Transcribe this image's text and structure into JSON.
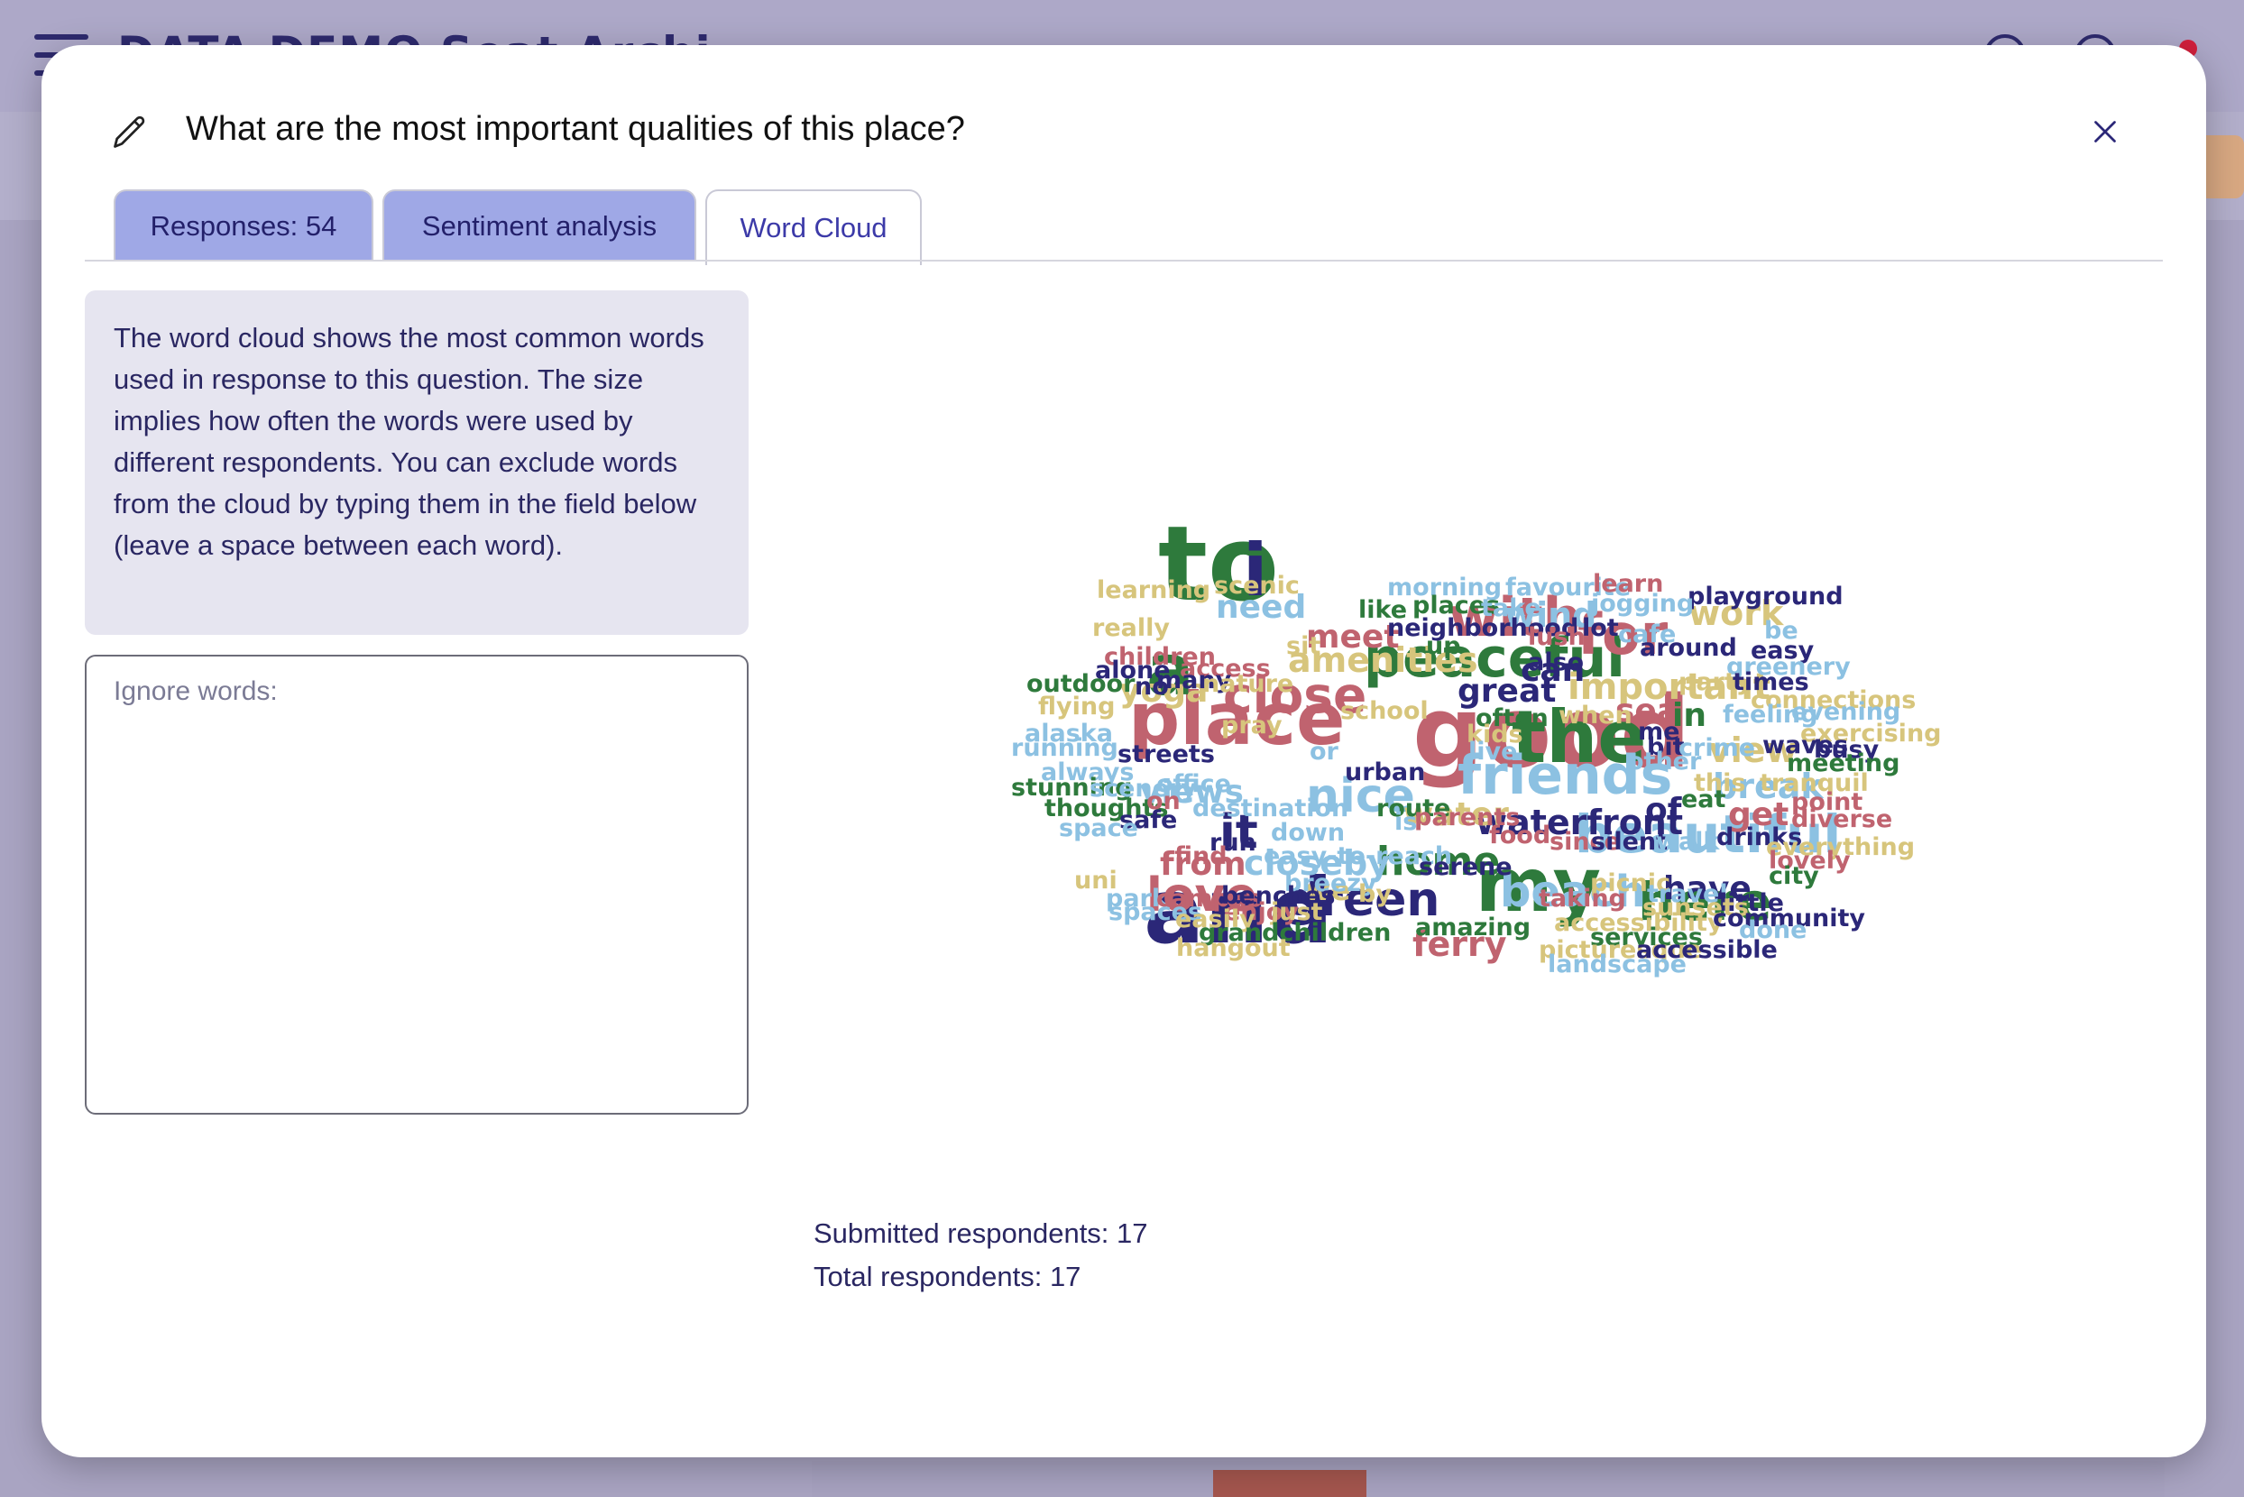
{
  "background": {
    "app_title": "DATA DEMO Seat Archi..."
  },
  "modal": {
    "title": "What are the most important qualities of this place?",
    "tabs": [
      {
        "label": "Responses: 54",
        "active": false
      },
      {
        "label": "Sentiment analysis",
        "active": false
      },
      {
        "label": "Word Cloud",
        "active": true
      }
    ],
    "info_text": "The word cloud shows the most common words used in response to this question. The size implies how often the words were used by different respondents. You can exclude words from the cloud by typing them in the field below (leave a space between each word).",
    "ignore_placeholder": "Ignore words:",
    "ignore_value": "",
    "submitted_label": "Submitted respondents: 17",
    "total_label": "Total respondents: 17"
  },
  "colors": {
    "green": "#2e7a3c",
    "pink": "#c0636f",
    "navy": "#2b2778",
    "lightblue": "#8cc1e2",
    "khaki": "#d7c57c"
  },
  "word_cloud": [
    {
      "text": "good",
      "weight": "xl",
      "color": "pink"
    },
    {
      "text": "to",
      "weight": "xl",
      "color": "green"
    },
    {
      "text": "and",
      "weight": "xl",
      "color": "navy"
    },
    {
      "text": "the",
      "weight": "l",
      "color": "green"
    },
    {
      "text": "place",
      "weight": "l",
      "color": "pink"
    },
    {
      "text": "my",
      "weight": "l",
      "color": "green"
    },
    {
      "text": "a",
      "weight": "l",
      "color": "green"
    },
    {
      "text": "i",
      "weight": "l",
      "color": "navy"
    },
    {
      "text": "friends",
      "weight": "m",
      "color": "lightblue"
    },
    {
      "text": "peaceful",
      "weight": "m",
      "color": "green"
    },
    {
      "text": "beautiful",
      "weight": "m",
      "color": "lightblue"
    },
    {
      "text": "for",
      "weight": "m",
      "color": "pink"
    },
    {
      "text": "with",
      "weight": "m",
      "color": "pink"
    },
    {
      "text": "close",
      "weight": "m",
      "color": "pink"
    },
    {
      "text": "nice",
      "weight": "m",
      "color": "lightblue"
    },
    {
      "text": "love",
      "weight": "m",
      "color": "pink"
    },
    {
      "text": "green",
      "weight": "m",
      "color": "navy"
    },
    {
      "text": "here",
      "weight": "m",
      "color": "green"
    },
    {
      "text": "beach",
      "weight": "m",
      "color": "lightblue"
    },
    {
      "text": "it",
      "weight": "m",
      "color": "navy"
    },
    {
      "text": "home",
      "weight": "s",
      "color": "green"
    },
    {
      "text": "waterfront",
      "weight": "s",
      "color": "navy"
    },
    {
      "text": "important",
      "weight": "s",
      "color": "khaki"
    },
    {
      "text": "amenities",
      "weight": "s",
      "color": "khaki"
    },
    {
      "text": "view",
      "weight": "s",
      "color": "khaki"
    },
    {
      "text": "break",
      "weight": "s",
      "color": "lightblue"
    },
    {
      "text": "closeby",
      "weight": "s",
      "color": "lightblue"
    },
    {
      "text": "from",
      "weight": "s",
      "color": "pink"
    },
    {
      "text": "water",
      "weight": "s",
      "color": "khaki"
    },
    {
      "text": "views",
      "weight": "s",
      "color": "lightblue"
    },
    {
      "text": "ferry",
      "weight": "s",
      "color": "pink"
    },
    {
      "text": "work",
      "weight": "s",
      "color": "khaki"
    },
    {
      "text": "wind",
      "weight": "s",
      "color": "lightblue"
    },
    {
      "text": "need",
      "weight": "s",
      "color": "lightblue"
    },
    {
      "text": "meet",
      "weight": "s",
      "color": "pink"
    },
    {
      "text": "great",
      "weight": "s",
      "color": "navy"
    },
    {
      "text": "yoga",
      "weight": "s",
      "color": "khaki"
    },
    {
      "text": "sea",
      "weight": "s",
      "color": "pink"
    },
    {
      "text": "in",
      "weight": "s",
      "color": "green"
    },
    {
      "text": "have",
      "weight": "s",
      "color": "navy"
    },
    {
      "text": "get",
      "weight": "s",
      "color": "pink"
    },
    {
      "text": "of",
      "weight": "s",
      "color": "navy"
    },
    {
      "text": "can",
      "weight": "s",
      "color": "navy"
    },
    {
      "text": "we",
      "weight": "s",
      "color": "khaki"
    },
    {
      "text": "learning",
      "weight": "xs",
      "color": "khaki"
    },
    {
      "text": "scenic",
      "weight": "xs",
      "color": "khaki"
    },
    {
      "text": "morning",
      "weight": "xs",
      "color": "lightblue"
    },
    {
      "text": "favourite",
      "weight": "xs",
      "color": "lightblue"
    },
    {
      "text": "learn",
      "weight": "xs",
      "color": "pink"
    },
    {
      "text": "playground",
      "weight": "xs",
      "color": "navy"
    },
    {
      "text": "like",
      "weight": "xs",
      "color": "green"
    },
    {
      "text": "places",
      "weight": "xs",
      "color": "green"
    },
    {
      "text": "take",
      "weight": "xs",
      "color": "lightblue"
    },
    {
      "text": "jogging",
      "weight": "xs",
      "color": "lightblue"
    },
    {
      "text": "neighborhood",
      "weight": "xs",
      "color": "navy"
    },
    {
      "text": "really",
      "weight": "xs",
      "color": "khaki"
    },
    {
      "text": "lush",
      "weight": "xs",
      "color": "pink"
    },
    {
      "text": "lot",
      "weight": "xs",
      "color": "navy"
    },
    {
      "text": "cafe",
      "weight": "xs",
      "color": "lightblue"
    },
    {
      "text": "be",
      "weight": "xs",
      "color": "lightblue"
    },
    {
      "text": "sit",
      "weight": "xs",
      "color": "khaki"
    },
    {
      "text": "up",
      "weight": "xs",
      "color": "green"
    },
    {
      "text": "around",
      "weight": "xs",
      "color": "navy"
    },
    {
      "text": "easy",
      "weight": "xs",
      "color": "navy"
    },
    {
      "text": "children",
      "weight": "xs",
      "color": "pink"
    },
    {
      "text": "also",
      "weight": "xs",
      "color": "navy"
    },
    {
      "text": "greenery",
      "weight": "xs",
      "color": "lightblue"
    },
    {
      "text": "alone",
      "weight": "xs",
      "color": "navy"
    },
    {
      "text": "access",
      "weight": "xs",
      "color": "pink"
    },
    {
      "text": "outdoor",
      "weight": "xs",
      "color": "green"
    },
    {
      "text": "no",
      "weight": "xs",
      "color": "navy"
    },
    {
      "text": "many",
      "weight": "xs",
      "color": "navy"
    },
    {
      "text": "nature",
      "weight": "xs",
      "color": "khaki"
    },
    {
      "text": "party",
      "weight": "xs",
      "color": "khaki"
    },
    {
      "text": "times",
      "weight": "xs",
      "color": "navy"
    },
    {
      "text": "connections",
      "weight": "xs",
      "color": "khaki"
    },
    {
      "text": "flying",
      "weight": "xs",
      "color": "khaki"
    },
    {
      "text": "school",
      "weight": "xs",
      "color": "khaki"
    },
    {
      "text": "often",
      "weight": "xs",
      "color": "green"
    },
    {
      "text": "when",
      "weight": "xs",
      "color": "khaki"
    },
    {
      "text": "feeling",
      "weight": "xs",
      "color": "lightblue"
    },
    {
      "text": "evening",
      "weight": "xs",
      "color": "lightblue"
    },
    {
      "text": "pray",
      "weight": "xs",
      "color": "khaki"
    },
    {
      "text": "kids",
      "weight": "xs",
      "color": "khaki"
    },
    {
      "text": "me",
      "weight": "xs",
      "color": "navy"
    },
    {
      "text": "alaska",
      "weight": "xs",
      "color": "lightblue"
    },
    {
      "text": "exercising",
      "weight": "xs",
      "color": "khaki"
    },
    {
      "text": "running",
      "weight": "xs",
      "color": "lightblue"
    },
    {
      "text": "or",
      "weight": "xs",
      "color": "lightblue"
    },
    {
      "text": "live",
      "weight": "xs",
      "color": "lightblue"
    },
    {
      "text": "bit",
      "weight": "xs",
      "color": "navy"
    },
    {
      "text": "crime",
      "weight": "xs",
      "color": "lightblue"
    },
    {
      "text": "waves",
      "weight": "xs",
      "color": "navy"
    },
    {
      "text": "busy",
      "weight": "xs",
      "color": "navy"
    },
    {
      "text": "streets",
      "weight": "xs",
      "color": "navy"
    },
    {
      "text": "always",
      "weight": "xs",
      "color": "lightblue"
    },
    {
      "text": "other",
      "weight": "xs",
      "color": "lightblue"
    },
    {
      "text": "meeting",
      "weight": "xs",
      "color": "green"
    },
    {
      "text": "urban",
      "weight": "xs",
      "color": "navy"
    },
    {
      "text": "this",
      "weight": "xs",
      "color": "khaki"
    },
    {
      "text": "tranquil",
      "weight": "xs",
      "color": "khaki"
    },
    {
      "text": "stunning",
      "weight": "xs",
      "color": "green"
    },
    {
      "text": "scenery",
      "weight": "xs",
      "color": "lightblue"
    },
    {
      "text": "office",
      "weight": "xs",
      "color": "lightblue"
    },
    {
      "text": "eat",
      "weight": "xs",
      "color": "green"
    },
    {
      "text": "point",
      "weight": "xs",
      "color": "pink"
    },
    {
      "text": "thoughts",
      "weight": "xs",
      "color": "green"
    },
    {
      "text": "on",
      "weight": "xs",
      "color": "pink"
    },
    {
      "text": "destination",
      "weight": "xs",
      "color": "lightblue"
    },
    {
      "text": "route",
      "weight": "xs",
      "color": "green"
    },
    {
      "text": "diverse",
      "weight": "xs",
      "color": "pink"
    },
    {
      "text": "safe",
      "weight": "xs",
      "color": "navy"
    },
    {
      "text": "is",
      "weight": "xs",
      "color": "lightblue"
    },
    {
      "text": "parents",
      "weight": "xs",
      "color": "pink"
    },
    {
      "text": "space",
      "weight": "xs",
      "color": "lightblue"
    },
    {
      "text": "down",
      "weight": "xs",
      "color": "lightblue"
    },
    {
      "text": "food",
      "weight": "xs",
      "color": "pink"
    },
    {
      "text": "since",
      "weight": "xs",
      "color": "pink"
    },
    {
      "text": "silent",
      "weight": "xs",
      "color": "navy"
    },
    {
      "text": "walk",
      "weight": "xs",
      "color": "lightblue"
    },
    {
      "text": "drinks",
      "weight": "xs",
      "color": "navy"
    },
    {
      "text": "run",
      "weight": "xs",
      "color": "navy"
    },
    {
      "text": "everything",
      "weight": "xs",
      "color": "khaki"
    },
    {
      "text": "find",
      "weight": "xs",
      "color": "pink"
    },
    {
      "text": "easy-to-reach",
      "weight": "xs",
      "color": "lightblue"
    },
    {
      "text": "lovely",
      "weight": "xs",
      "color": "pink"
    },
    {
      "text": "serene",
      "weight": "xs",
      "color": "navy"
    },
    {
      "text": "city",
      "weight": "xs",
      "color": "green"
    },
    {
      "text": "uni",
      "weight": "xs",
      "color": "khaki"
    },
    {
      "text": "breezy",
      "weight": "xs",
      "color": "lightblue"
    },
    {
      "text": "picnic",
      "weight": "xs",
      "color": "khaki"
    },
    {
      "text": "park",
      "weight": "xs",
      "color": "lightblue"
    },
    {
      "text": "campus",
      "weight": "xs",
      "color": "pink"
    },
    {
      "text": "benches",
      "weight": "xs",
      "color": "navy"
    },
    {
      "text": "by",
      "weight": "xs",
      "color": "khaki"
    },
    {
      "text": "taking",
      "weight": "xs",
      "color": "pink"
    },
    {
      "text": "travel",
      "weight": "xs",
      "color": "lightblue"
    },
    {
      "text": "little",
      "weight": "xs",
      "color": "navy"
    },
    {
      "text": "spaces",
      "weight": "xs",
      "color": "lightblue"
    },
    {
      "text": "enjoy",
      "weight": "xs",
      "color": "pink"
    },
    {
      "text": "just",
      "weight": "xs",
      "color": "khaki"
    },
    {
      "text": "sunsets",
      "weight": "xs",
      "color": "khaki"
    },
    {
      "text": "easily",
      "weight": "xs",
      "color": "khaki"
    },
    {
      "text": "amazing",
      "weight": "xs",
      "color": "green"
    },
    {
      "text": "accessibility",
      "weight": "xs",
      "color": "khaki"
    },
    {
      "text": "community",
      "weight": "xs",
      "color": "navy"
    },
    {
      "text": "done",
      "weight": "xs",
      "color": "lightblue"
    },
    {
      "text": "grandchildren",
      "weight": "xs",
      "color": "green"
    },
    {
      "text": "services",
      "weight": "xs",
      "color": "green"
    },
    {
      "text": "hangout",
      "weight": "xs",
      "color": "khaki"
    },
    {
      "text": "picturesque",
      "weight": "xs",
      "color": "khaki"
    },
    {
      "text": "accessible",
      "weight": "xs",
      "color": "navy"
    },
    {
      "text": "landscape",
      "weight": "xs",
      "color": "lightblue"
    }
  ]
}
